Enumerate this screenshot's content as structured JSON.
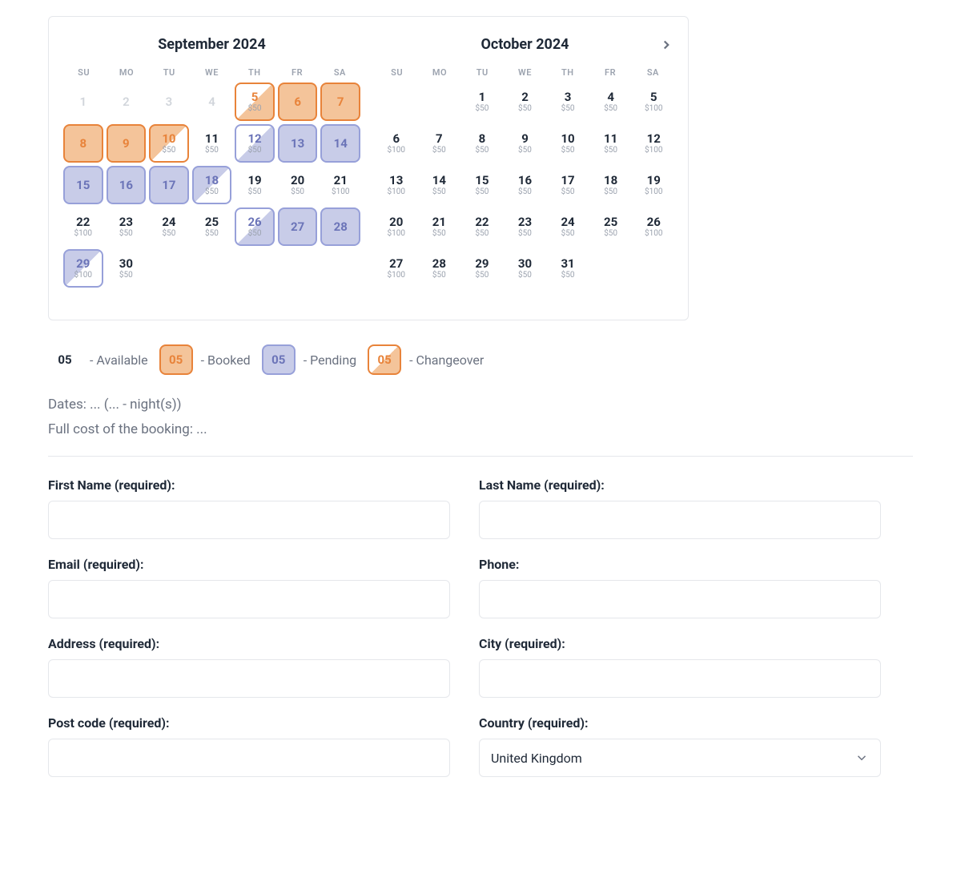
{
  "calendar": {
    "dow": [
      "SU",
      "MO",
      "TU",
      "WE",
      "TH",
      "FR",
      "SA"
    ],
    "months": [
      {
        "title": "September 2024",
        "startOffset": 0,
        "days": [
          {
            "d": "1",
            "state": "past"
          },
          {
            "d": "2",
            "state": "past"
          },
          {
            "d": "3",
            "state": "past"
          },
          {
            "d": "4",
            "state": "past"
          },
          {
            "d": "5",
            "price": "$50",
            "state": "changeover-b"
          },
          {
            "d": "6",
            "state": "booked"
          },
          {
            "d": "7",
            "state": "booked"
          },
          {
            "d": "8",
            "state": "booked"
          },
          {
            "d": "9",
            "state": "booked"
          },
          {
            "d": "10",
            "price": "$50",
            "state": "changeover-bp"
          },
          {
            "d": "11",
            "price": "$50",
            "state": "available"
          },
          {
            "d": "12",
            "price": "$50",
            "state": "changeover-p-start"
          },
          {
            "d": "13",
            "state": "pending"
          },
          {
            "d": "14",
            "state": "pending"
          },
          {
            "d": "15",
            "state": "pending"
          },
          {
            "d": "16",
            "state": "pending"
          },
          {
            "d": "17",
            "state": "pending"
          },
          {
            "d": "18",
            "price": "$50",
            "state": "changeover-p-end"
          },
          {
            "d": "19",
            "price": "$50",
            "state": "available"
          },
          {
            "d": "20",
            "price": "$50",
            "state": "available"
          },
          {
            "d": "21",
            "price": "$100",
            "state": "available"
          },
          {
            "d": "22",
            "price": "$100",
            "state": "available"
          },
          {
            "d": "23",
            "price": "$50",
            "state": "available"
          },
          {
            "d": "24",
            "price": "$50",
            "state": "available"
          },
          {
            "d": "25",
            "price": "$50",
            "state": "available"
          },
          {
            "d": "26",
            "price": "$50",
            "state": "changeover-p-start"
          },
          {
            "d": "27",
            "state": "pending"
          },
          {
            "d": "28",
            "state": "pending"
          },
          {
            "d": "29",
            "price": "$100",
            "state": "changeover-p-end"
          },
          {
            "d": "30",
            "price": "$50",
            "state": "available"
          }
        ]
      },
      {
        "title": "October 2024",
        "startOffset": 2,
        "days": [
          {
            "d": "1",
            "price": "$50",
            "state": "available"
          },
          {
            "d": "2",
            "price": "$50",
            "state": "available"
          },
          {
            "d": "3",
            "price": "$50",
            "state": "available"
          },
          {
            "d": "4",
            "price": "$50",
            "state": "available"
          },
          {
            "d": "5",
            "price": "$100",
            "state": "available"
          },
          {
            "d": "6",
            "price": "$100",
            "state": "available"
          },
          {
            "d": "7",
            "price": "$50",
            "state": "available"
          },
          {
            "d": "8",
            "price": "$50",
            "state": "available"
          },
          {
            "d": "9",
            "price": "$50",
            "state": "available"
          },
          {
            "d": "10",
            "price": "$50",
            "state": "available"
          },
          {
            "d": "11",
            "price": "$50",
            "state": "available"
          },
          {
            "d": "12",
            "price": "$100",
            "state": "available"
          },
          {
            "d": "13",
            "price": "$100",
            "state": "available"
          },
          {
            "d": "14",
            "price": "$50",
            "state": "available"
          },
          {
            "d": "15",
            "price": "$50",
            "state": "available"
          },
          {
            "d": "16",
            "price": "$50",
            "state": "available"
          },
          {
            "d": "17",
            "price": "$50",
            "state": "available"
          },
          {
            "d": "18",
            "price": "$50",
            "state": "available"
          },
          {
            "d": "19",
            "price": "$100",
            "state": "available"
          },
          {
            "d": "20",
            "price": "$100",
            "state": "available"
          },
          {
            "d": "21",
            "price": "$50",
            "state": "available"
          },
          {
            "d": "22",
            "price": "$50",
            "state": "available"
          },
          {
            "d": "23",
            "price": "$50",
            "state": "available"
          },
          {
            "d": "24",
            "price": "$50",
            "state": "available"
          },
          {
            "d": "25",
            "price": "$50",
            "state": "available"
          },
          {
            "d": "26",
            "price": "$100",
            "state": "available"
          },
          {
            "d": "27",
            "price": "$100",
            "state": "available"
          },
          {
            "d": "28",
            "price": "$50",
            "state": "available"
          },
          {
            "d": "29",
            "price": "$50",
            "state": "available"
          },
          {
            "d": "30",
            "price": "$50",
            "state": "available"
          },
          {
            "d": "31",
            "price": "$50",
            "state": "available"
          }
        ]
      }
    ]
  },
  "legend": {
    "sample": "05",
    "available": "- Available",
    "booked": "- Booked",
    "pending": "- Pending",
    "changeover": "- Changeover"
  },
  "summary": {
    "dates": "Dates: ... (... - night(s))",
    "cost": "Full cost of the booking: ..."
  },
  "form": {
    "firstName": "First Name (required):",
    "lastName": "Last Name (required):",
    "email": "Email (required):",
    "phone": "Phone:",
    "address": "Address (required):",
    "city": "City (required):",
    "postcode": "Post code (required):",
    "country": "Country (required):",
    "countryValue": "United Kingdom"
  }
}
